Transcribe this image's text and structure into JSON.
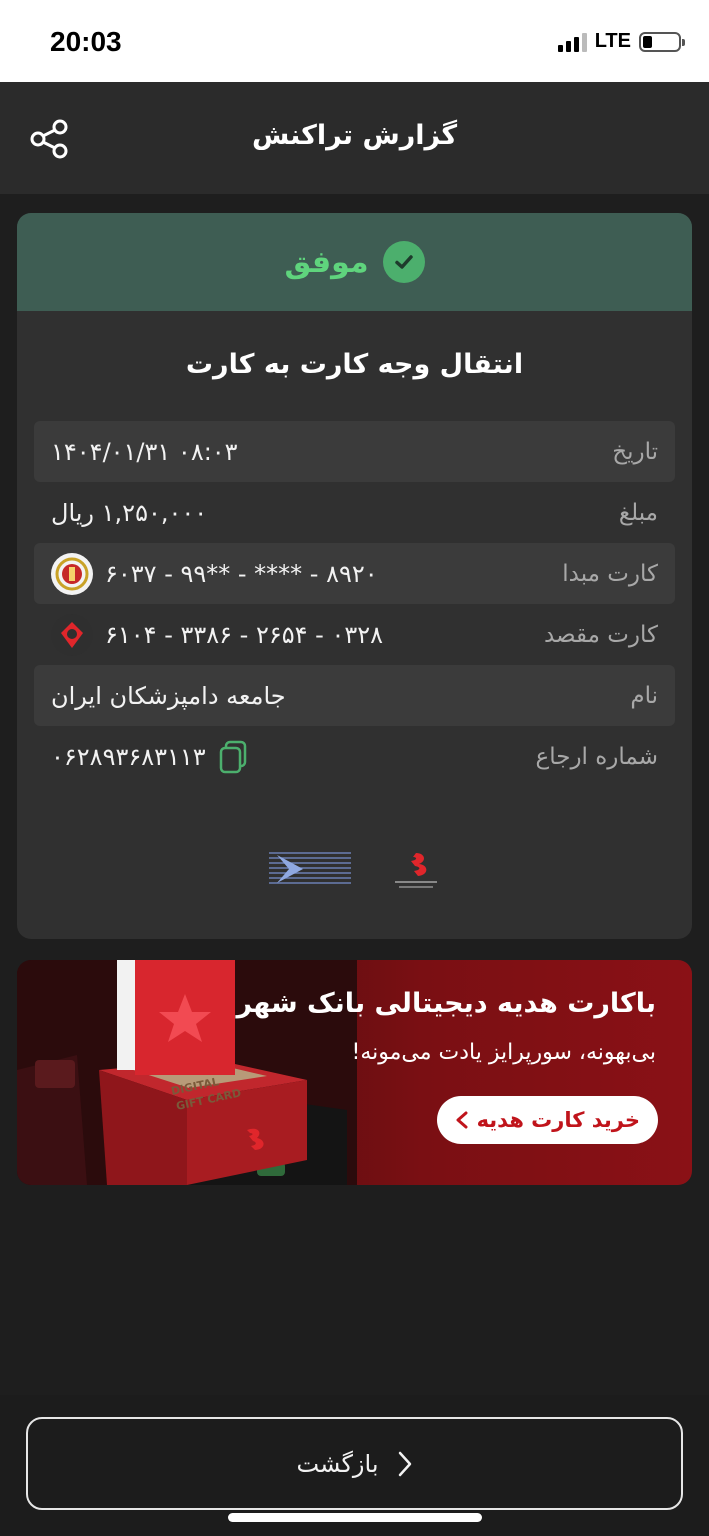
{
  "status_bar": {
    "time": "20:03",
    "network": "LTE",
    "battery_level": 0.25
  },
  "app_bar": {
    "title": "گزارش تراکنش",
    "share_icon": "share-icon"
  },
  "receipt": {
    "status_label": "موفق",
    "status_color": "#5fd47d",
    "transaction_type": "انتقال وجه کارت به کارت",
    "rows": [
      {
        "label": "تاریخ",
        "value": "۱۴۰۴/۰۱/۳۱ ۰۸:۰۳"
      },
      {
        "label": "مبلغ",
        "value": "۱,۲۵۰,۰۰۰ ریال"
      },
      {
        "label": "کارت مبدا",
        "value": "۶۰۳۷ - ۹۹** - **** - ۸۹۲۰"
      },
      {
        "label": "کارت مقصد",
        "value": "۶۱۰۴ - ۳۳۸۶ - ۲۶۵۴ - ۰۳۲۸"
      },
      {
        "label": "نام",
        "value": "جامعه دامپزشکان ایران"
      },
      {
        "label": "شماره ارجاع",
        "value": "۰۶۲۸۹۳۶۸۳۱۱۳"
      }
    ]
  },
  "banner": {
    "headline": "باکارت هدیه دیجیتالی بانک شهر",
    "subline": "بی‌بهونه، سورپرایز یادت می‌مونه!",
    "cta_label": "خرید کارت هدیه",
    "card_text_1": "DIGITAL",
    "card_text_2": "GIFT CARD",
    "brand_color": "#c0141b"
  },
  "footer": {
    "back_label": "بازگشت"
  }
}
